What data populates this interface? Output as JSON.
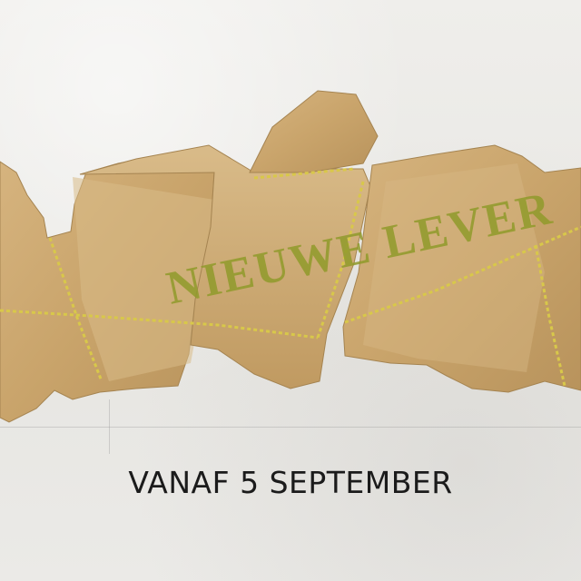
{
  "stamp_text": "NIEUWE LEVER",
  "tagline": "VANAF 5 SEPTEMBER",
  "colors": {
    "background": "#ecebe8",
    "paper": "#c9a46b",
    "paper_light": "#d8b885",
    "stamp": "#8f9a2a",
    "string": "#d8c84a",
    "text": "#1b1b1b"
  }
}
